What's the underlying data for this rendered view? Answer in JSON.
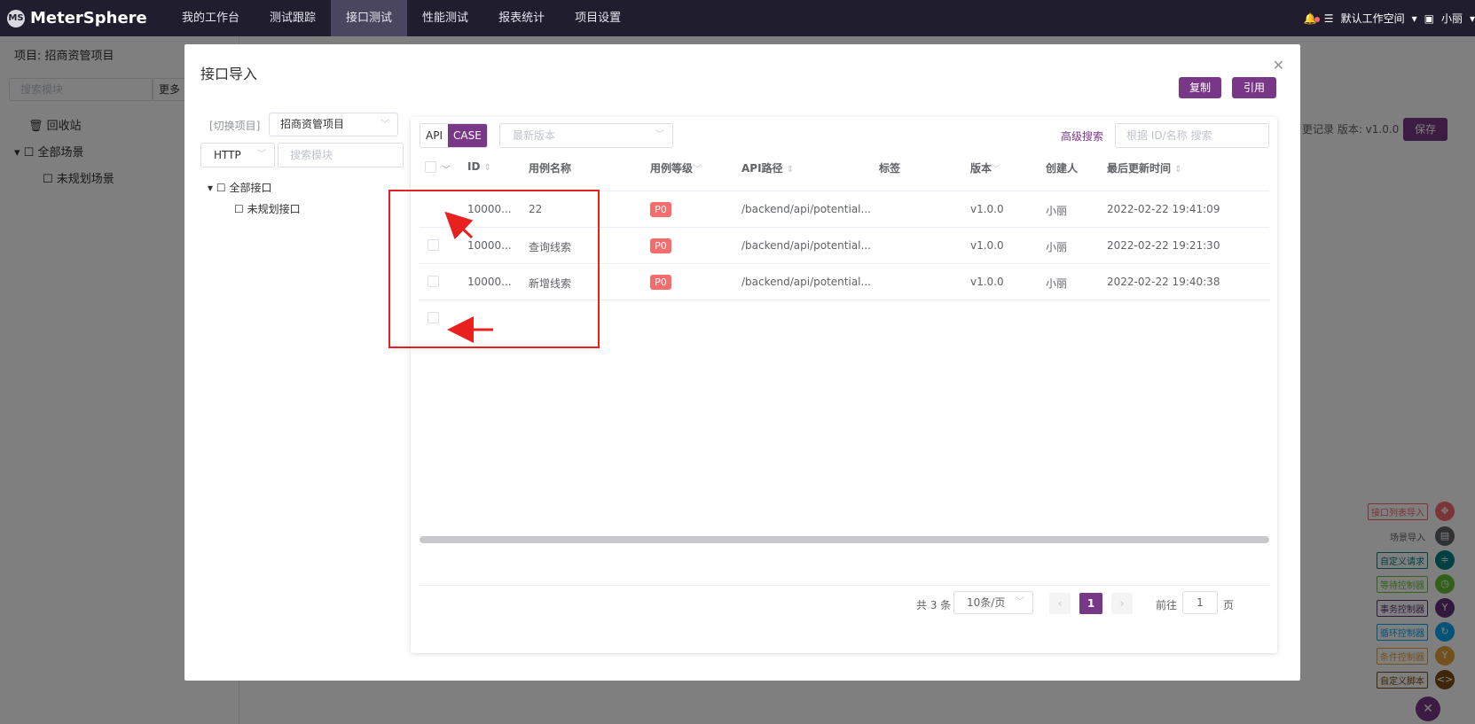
{
  "app": {
    "name": "MeterSphere"
  },
  "nav": [
    "我的工作台",
    "测试跟踪",
    "接口测试",
    "性能测试",
    "报表统计",
    "项目设置"
  ],
  "top_right": {
    "workspace": "默认工作空间",
    "user": "小丽"
  },
  "background": {
    "project_label": "项目: 招商资管项目",
    "search_placeholder": "搜索模块",
    "more": "更多操作",
    "tree": [
      "回收站",
      "全部场景",
      "未规划场景"
    ],
    "right_text": "更记录 版本: v1.0.0",
    "save": "保存",
    "tools": [
      {
        "label": "接口列表导入",
        "color": "#f56c6c"
      },
      {
        "label": "场景导入",
        "color": "#606266"
      },
      {
        "label": "自定义请求",
        "color": "#008080"
      },
      {
        "label": "等待控制器",
        "color": "#67c23a"
      },
      {
        "label": "事务控制器",
        "color": "#62317a"
      },
      {
        "label": "循环控制器",
        "color": "#02a7f0"
      },
      {
        "label": "条件控制器",
        "color": "#e6a23c"
      },
      {
        "label": "自定义脚本",
        "color": "#7b4d12"
      }
    ]
  },
  "dialog": {
    "title": "接口导入",
    "copy_button": "复制",
    "ref_button": "引用",
    "switch_project_label": "[切换项目]",
    "project_value": "招商资管项目",
    "protocol": "HTTP",
    "module_search_placeholder": "搜索模块",
    "tree": {
      "root": "全部接口",
      "child": "未规划接口"
    },
    "tabs": {
      "api": "API",
      "case": "CASE"
    },
    "version_placeholder": "最新版本",
    "advanced_search": "高级搜索",
    "id_search_placeholder": "根据 ID/名称 搜索",
    "columns": [
      "ID",
      "用例名称",
      "用例等级",
      "API路径",
      "标签",
      "版本",
      "创建人",
      "最后更新时间"
    ],
    "rows": [
      {
        "id": "10000...",
        "name": "22",
        "level": "P0",
        "path": "/backend/api/potential...",
        "tag": "",
        "version": "v1.0.0",
        "creator": "小丽",
        "updated": "2022-02-22 19:41:09"
      },
      {
        "id": "10000...",
        "name": "查询线索",
        "level": "P0",
        "path": "/backend/api/potential...",
        "tag": "",
        "version": "v1.0.0",
        "creator": "小丽",
        "updated": "2022-02-22 19:21:30"
      },
      {
        "id": "10000...",
        "name": "新增线索",
        "level": "P0",
        "path": "/backend/api/potential...",
        "tag": "",
        "version": "v1.0.0",
        "creator": "小丽",
        "updated": "2022-02-22 19:40:38"
      }
    ],
    "pagination": {
      "total": "共 3 条",
      "page_size": "10条/页",
      "current": "1",
      "goto_prefix": "前往",
      "goto_value": "1",
      "goto_suffix": "页"
    }
  }
}
